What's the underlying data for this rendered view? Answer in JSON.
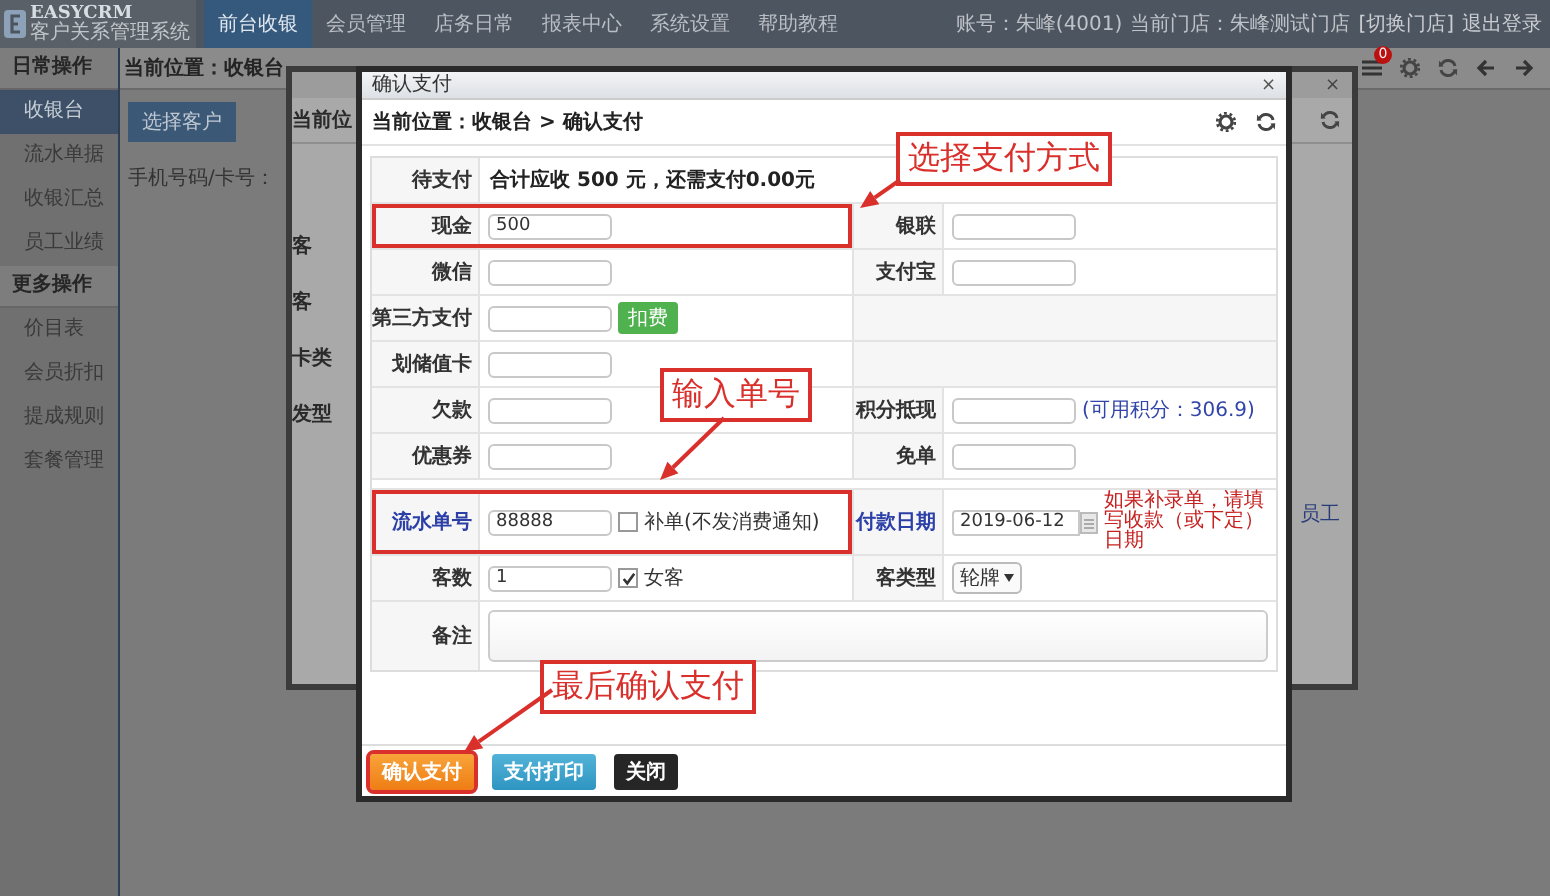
{
  "top_bar": {
    "logo": {
      "title": "EASYCRM",
      "subtitle": "客户关系管理系统"
    },
    "nav": [
      {
        "label": "前台收银",
        "selected": true
      },
      {
        "label": "会员管理",
        "selected": false
      },
      {
        "label": "店务日常",
        "selected": false
      },
      {
        "label": "报表中心",
        "selected": false
      },
      {
        "label": "系统设置",
        "selected": false
      },
      {
        "label": "帮助教程",
        "selected": false
      }
    ],
    "account": [
      {
        "text": "账号：朱峰(4001)",
        "kind": "text"
      },
      {
        "text": "当前门店：朱峰测试门店",
        "kind": "text"
      },
      {
        "text": "[切换门店]",
        "kind": "link"
      },
      {
        "text": "退出登录",
        "kind": "link"
      }
    ]
  },
  "sidebar": {
    "items": [
      {
        "label": "日常操作",
        "kind": "heading"
      },
      {
        "label": "收银台",
        "kind": "item",
        "selected": true
      },
      {
        "label": "流水单据",
        "kind": "item",
        "selected": false
      },
      {
        "label": "收银汇总",
        "kind": "item",
        "selected": false
      },
      {
        "label": "员工业绩",
        "kind": "item",
        "selected": false
      },
      {
        "label": "更多操作",
        "kind": "heading"
      },
      {
        "label": "价目表",
        "kind": "item",
        "selected": false
      },
      {
        "label": "会员折扣",
        "kind": "item",
        "selected": false
      },
      {
        "label": "提成规则",
        "kind": "item",
        "selected": false
      },
      {
        "label": "套餐管理",
        "kind": "item",
        "selected": false
      }
    ]
  },
  "main": {
    "breadcrumb": "当前位置：收银台",
    "notification_badge": "0",
    "select_customer_button": "选择客户",
    "phone_label": "手机号码/卡号："
  },
  "background_dialog": {
    "close": "×",
    "left_texts": [
      "当前位",
      "客",
      "客",
      "卡类",
      "发型"
    ],
    "right_link": "员工"
  },
  "dialog": {
    "title": "确认支付",
    "close": "×",
    "breadcrumb": "当前位置：收银台 > 确认支付",
    "rows": [
      {
        "kind": "summary",
        "label": "待支付",
        "text": "合计应收 500 元，还需支付0.00元"
      },
      {
        "kind": "pair",
        "left": {
          "label": "现金",
          "kind": "input",
          "value": "500",
          "link": false,
          "highlighted": true
        },
        "right": {
          "label": "银联",
          "kind": "input",
          "link": false,
          "highlighted": false
        }
      },
      {
        "kind": "pair",
        "left": {
          "label": "微信",
          "kind": "input",
          "link": false,
          "highlighted": false
        },
        "right": {
          "label": "支付宝",
          "kind": "input",
          "link": false,
          "highlighted": false
        }
      },
      {
        "kind": "pair",
        "left": {
          "label": "第三方支付",
          "kind": "input_button",
          "button": "扣费",
          "link": false,
          "highlighted": false
        },
        "right": {
          "kind": "empty",
          "highlighted": false
        }
      },
      {
        "kind": "pair",
        "left": {
          "label": "划储值卡",
          "kind": "input",
          "link": false,
          "highlighted": false
        },
        "right": {
          "kind": "empty",
          "highlighted": false
        }
      },
      {
        "kind": "pair",
        "left": {
          "label": "欠款",
          "kind": "input",
          "link": false,
          "highlighted": false
        },
        "right": {
          "label": "积分抵现",
          "kind": "input_note",
          "note": "(可用积分：306.9)",
          "link": false,
          "highlighted": false
        }
      },
      {
        "kind": "pair",
        "left": {
          "label": "优惠券",
          "kind": "input",
          "link": false,
          "highlighted": false
        },
        "right": {
          "label": "免单",
          "kind": "input",
          "link": false,
          "highlighted": false
        }
      },
      {
        "kind": "pair",
        "left": {
          "label": "流水单号",
          "kind": "input_checkbox",
          "value": "88888",
          "checkbox": "补单(不发消费通知)",
          "checked": false,
          "link": true,
          "highlighted": true
        },
        "right": {
          "label": "付款日期",
          "kind": "date",
          "value": "2019-06-12",
          "note": "如果补录单，请填写收款（或下定）日期",
          "link": true,
          "highlighted": false
        }
      },
      {
        "kind": "pair",
        "left": {
          "label": "客数",
          "kind": "input_checkbox",
          "value": "1",
          "checkbox": "女客",
          "checked": true,
          "link": false,
          "highlighted": false
        },
        "right": {
          "label": "客类型",
          "kind": "select",
          "value": "轮牌",
          "link": false,
          "highlighted": false
        }
      },
      {
        "kind": "note",
        "label": "备注"
      }
    ],
    "buttons": [
      {
        "label": "确认支付",
        "kind": "confirm",
        "highlighted": true
      },
      {
        "label": "支付打印",
        "kind": "print",
        "highlighted": false
      },
      {
        "label": "关闭",
        "kind": "close",
        "highlighted": false
      }
    ]
  },
  "annotations": [
    {
      "text": "选择支付方式"
    },
    {
      "text": "输入单号"
    },
    {
      "text": "最后确认支付"
    }
  ]
}
